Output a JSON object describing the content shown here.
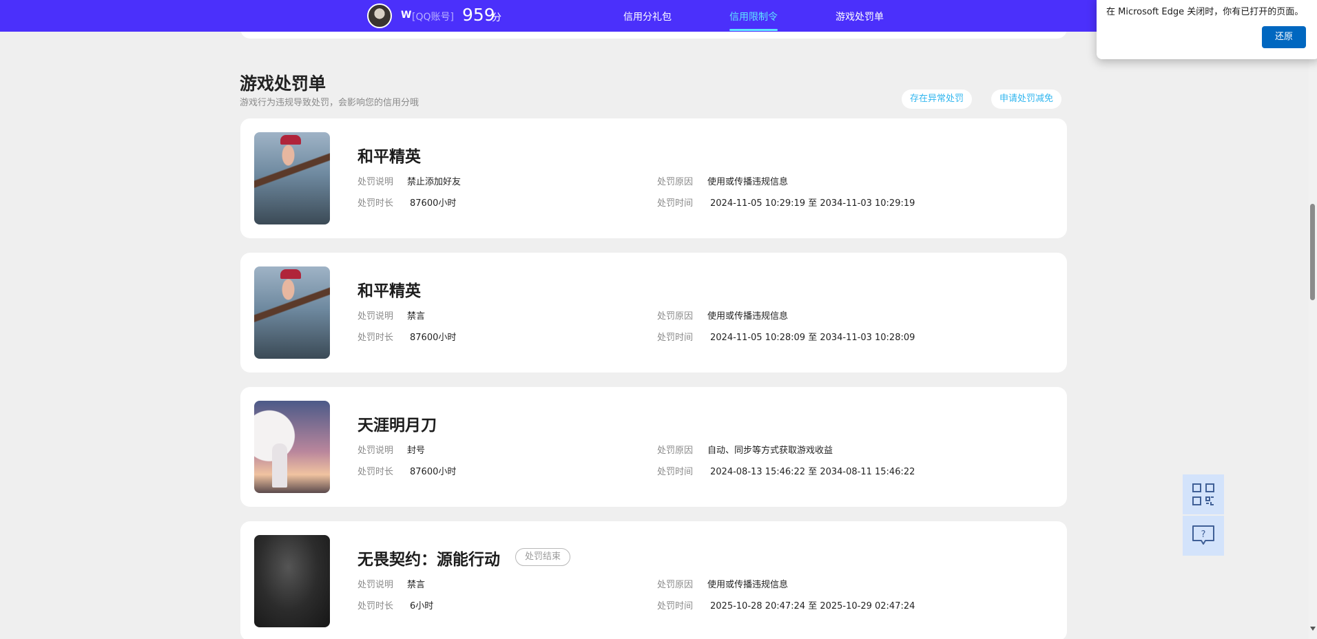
{
  "header": {
    "user_name": "W",
    "account_tag": "[QQ账号]",
    "score": "959",
    "score_unit": "分",
    "nav": [
      {
        "label": "信用分礼包"
      },
      {
        "label": "信用限制令"
      },
      {
        "label": "游戏处罚单"
      }
    ],
    "active_nav": "信用限制令",
    "accent_color": "#4b30fb"
  },
  "edge_notification": {
    "message": "在 Microsoft Edge 关闭时，你有已打开的页面。",
    "restore_label": "还原"
  },
  "section": {
    "title": "游戏处罚单",
    "subtitle": "游戏行为违规导致处罚，会影响您的信用分哦",
    "buttons": [
      "存在异常处罚",
      "申请处罚减免"
    ]
  },
  "labels": {
    "desc": "处罚说明",
    "duration": "处罚时长",
    "reason": "处罚原因",
    "time": "处罚时间"
  },
  "penalties": [
    {
      "game": "和平精英",
      "icon": "pubg-mobile-cover",
      "desc": "禁止添加好友",
      "duration": "87600小时",
      "reason": "使用或传播违规信息",
      "time": "2024-11-05 10:29:19 至 2034-11-03 10:29:19"
    },
    {
      "game": "和平精英",
      "icon": "pubg-mobile-cover",
      "desc": "禁言",
      "duration": "87600小时",
      "reason": "使用或传播违规信息",
      "time": "2024-11-05 10:28:09 至 2034-11-03 10:28:09"
    },
    {
      "game": "天涯明月刀",
      "icon": "moonlight-blade-cover",
      "desc": "封号",
      "duration": "87600小时",
      "reason": "自动、同步等方式获取游戏收益",
      "time": "2024-08-13 15:46:22 至 2034-08-11 15:46:22"
    },
    {
      "game": "无畏契约：源能行动",
      "icon": "valorant-cover",
      "status": "处罚结束",
      "desc": "禁言",
      "duration": "6小时",
      "reason": "使用或传播违规信息",
      "time": "2025-10-28 20:47:24 至 2025-10-29 02:47:24"
    }
  ],
  "side_tools": [
    {
      "icon": "qr-code-icon"
    },
    {
      "icon": "help-question-icon"
    }
  ]
}
